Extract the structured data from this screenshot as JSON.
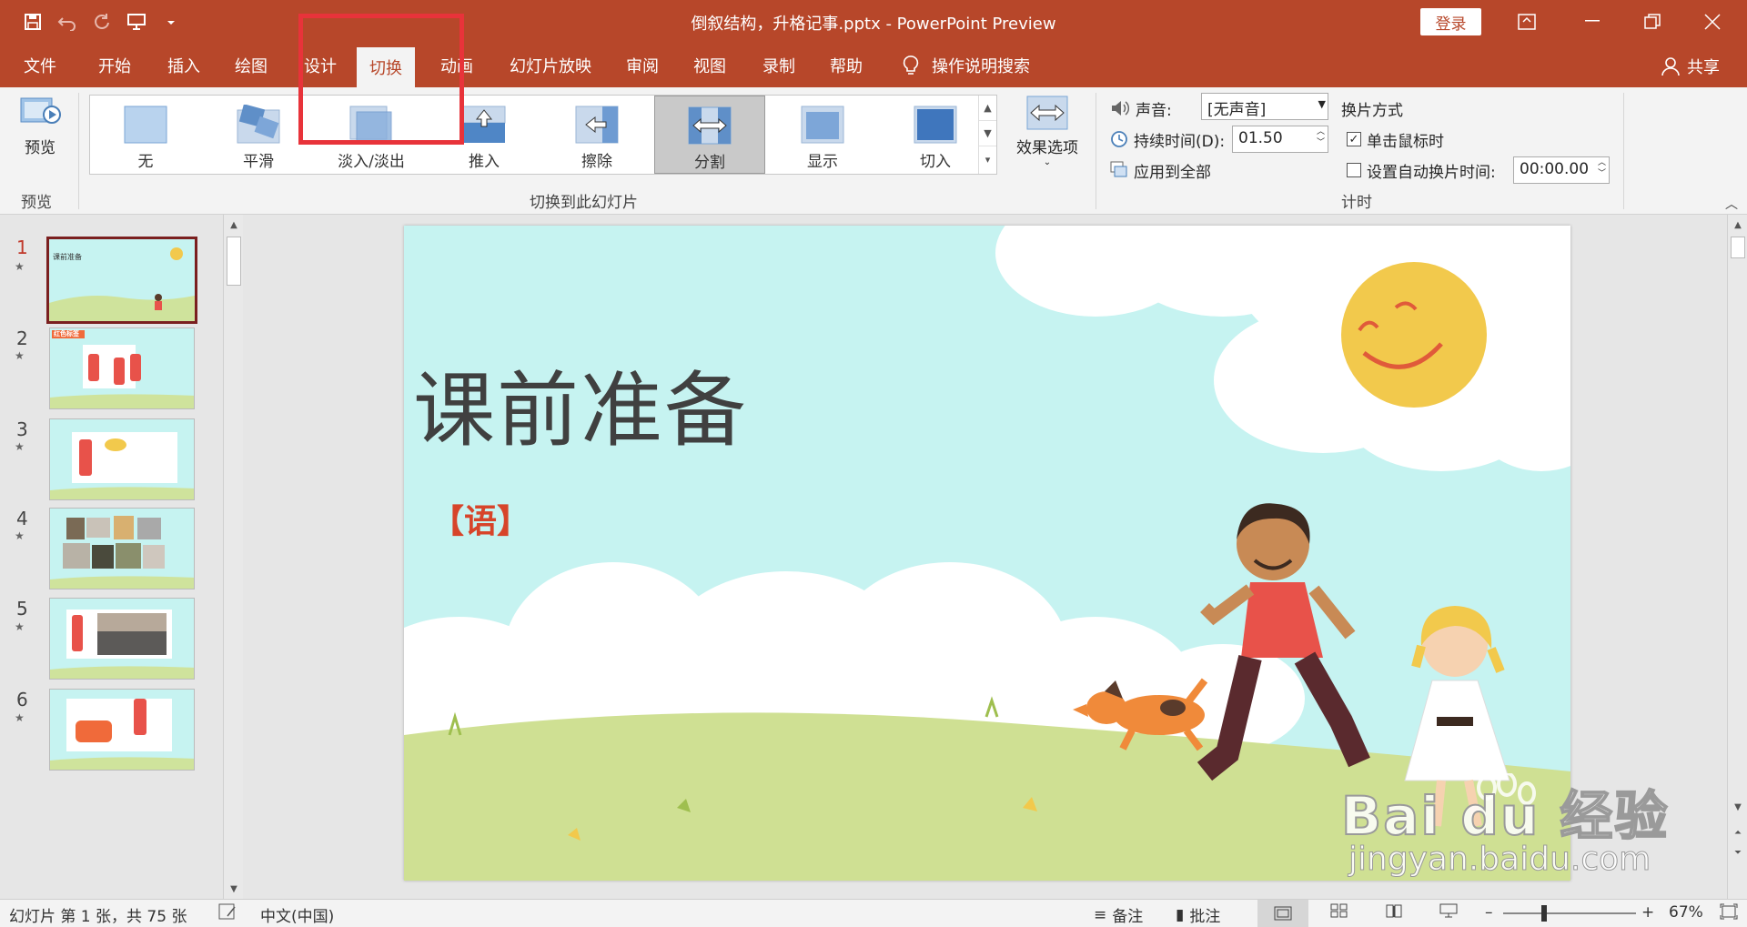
{
  "window": {
    "title": "倒叙结构，升格记事.pptx  -  PowerPoint Preview",
    "login_label": "登录"
  },
  "tabs": [
    "文件",
    "开始",
    "插入",
    "绘图",
    "设计",
    "切换",
    "动画",
    "幻灯片放映",
    "审阅",
    "视图",
    "录制",
    "帮助"
  ],
  "active_tab": "切换",
  "search_label": "操作说明搜索",
  "share_label": "共享",
  "ribbon": {
    "preview_label": "预览",
    "preview_group": "预览",
    "transitions": [
      "无",
      "平滑",
      "淡入/淡出",
      "推入",
      "擦除",
      "分割",
      "显示",
      "切入"
    ],
    "selected_transition": "分割",
    "transitions_group": "切换到此幻灯片",
    "effect_options": "效果选项",
    "sound_label": "声音:",
    "sound_value": "[无声音]",
    "duration_label": "持续时间(D):",
    "duration_value": "01.50",
    "apply_all": "应用到全部",
    "advance_label": "换片方式",
    "on_click_label": "单击鼠标时",
    "on_click_checked": true,
    "auto_after_label": "设置自动换片时间:",
    "auto_after_value": "00:00.00",
    "auto_after_checked": false,
    "timing_group": "计时"
  },
  "slides": [
    {
      "num": "1",
      "title": "课前准备"
    },
    {
      "num": "2",
      "title": "红色标签"
    },
    {
      "num": "3",
      "title": ""
    },
    {
      "num": "4",
      "title": ""
    },
    {
      "num": "5",
      "title": ""
    },
    {
      "num": "6",
      "title": ""
    }
  ],
  "current_slide": {
    "title": "课前准备",
    "subtitle": "【语】"
  },
  "status": {
    "slide_info": "幻灯片 第 1 张，共 75 张",
    "language": "中文(中国)",
    "notes": "备注",
    "comments": "批注",
    "zoom": "67%"
  },
  "watermark": {
    "brand": "Bai du 经验",
    "url": "jingyan.baidu.com"
  },
  "colors": {
    "accent": "#b7472a",
    "highlight_box": "#e8333a",
    "slide_bg": "#c6f3f1",
    "subtitle": "#d7442a"
  }
}
